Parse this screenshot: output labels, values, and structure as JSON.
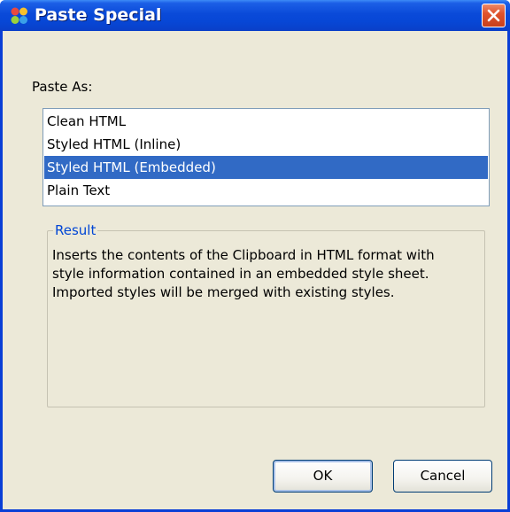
{
  "window": {
    "title": "Paste Special",
    "close_icon": "close-icon"
  },
  "paste_as": {
    "label": "Paste As:",
    "items": [
      {
        "label": "Clean HTML",
        "selected": false
      },
      {
        "label": "Styled HTML (Inline)",
        "selected": false
      },
      {
        "label": "Styled HTML (Embedded)",
        "selected": true
      },
      {
        "label": "Plain Text",
        "selected": false
      }
    ],
    "selected_color": "#316ac5"
  },
  "result": {
    "legend": "Result",
    "lines": [
      "Inserts the contents of the Clipboard in HTML format with",
      "style information contained in an embedded style sheet.",
      "Imported styles will be merged with existing styles."
    ],
    "legend_color": "#0046d5"
  },
  "buttons": {
    "ok_label": "OK",
    "cancel_label": "Cancel"
  },
  "colors": {
    "titlebar": "#0a4ad9",
    "dialog_background": "#ece9d8",
    "close_button": "#e0532c"
  }
}
